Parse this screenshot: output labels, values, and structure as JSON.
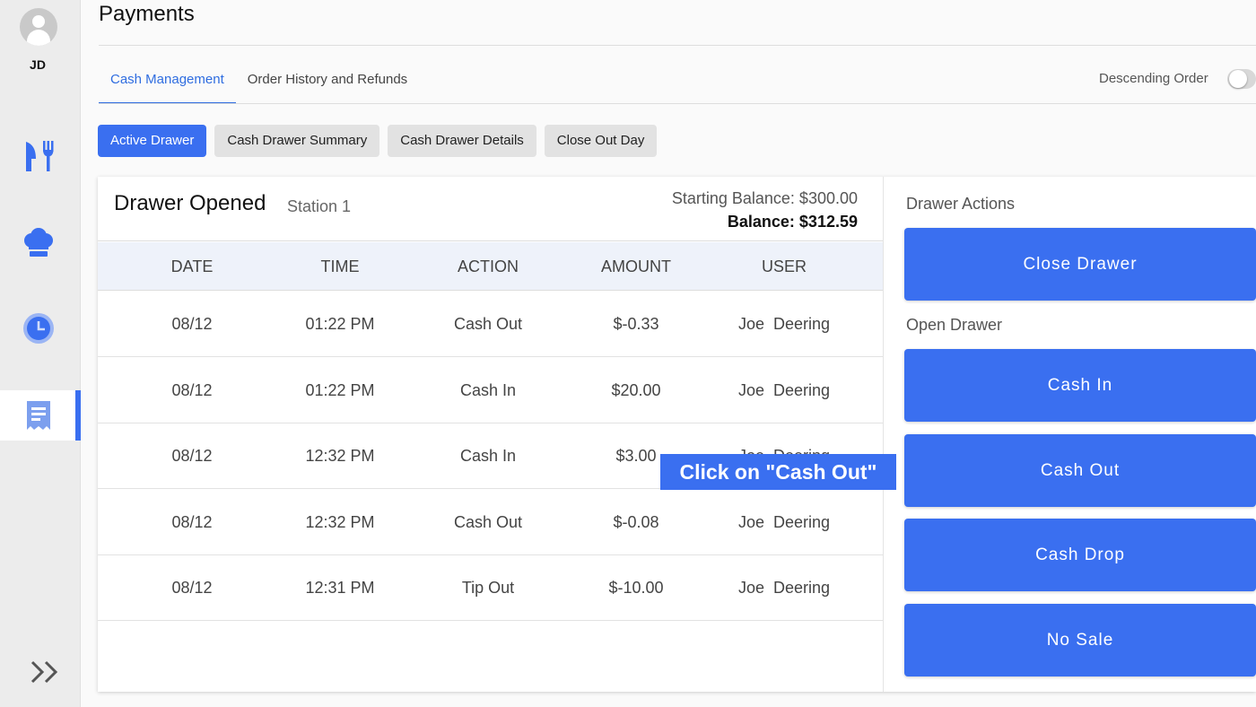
{
  "user": {
    "initials": "JD"
  },
  "page": {
    "title": "Payments"
  },
  "tabs": [
    {
      "label": "Cash Management",
      "active": true
    },
    {
      "label": "Order History and Refunds",
      "active": false
    }
  ],
  "sort": {
    "label": "Descending Order",
    "on": false
  },
  "subtabs": [
    {
      "label": "Active Drawer",
      "active": true
    },
    {
      "label": "Cash Drawer Summary",
      "active": false
    },
    {
      "label": "Cash Drawer Details",
      "active": false
    },
    {
      "label": "Close Out Day",
      "active": false
    }
  ],
  "drawer": {
    "title": "Drawer Opened",
    "station": "Station 1",
    "starting_balance": "Starting Balance: $300.00",
    "balance": "Balance: $312.59"
  },
  "table": {
    "headers": [
      "DATE",
      "TIME",
      "ACTION",
      "AMOUNT",
      "USER"
    ],
    "rows": [
      [
        "08/12",
        "01:22 PM",
        "Cash Out",
        "$-0.33",
        "Joe  Deering"
      ],
      [
        "08/12",
        "01:22 PM",
        "Cash In",
        "$20.00",
        "Joe  Deering"
      ],
      [
        "08/12",
        "12:32 PM",
        "Cash In",
        "$3.00",
        "Joe  Deering"
      ],
      [
        "08/12",
        "12:32 PM",
        "Cash Out",
        "$-0.08",
        "Joe  Deering"
      ],
      [
        "08/12",
        "12:31 PM",
        "Tip Out",
        "$-10.00",
        "Joe  Deering"
      ]
    ]
  },
  "actions": {
    "drawer_actions_label": "Drawer Actions",
    "close_drawer": "Close Drawer",
    "open_drawer_label": "Open Drawer",
    "cash_in": "Cash In",
    "cash_out": "Cash Out",
    "cash_drop": "Cash Drop",
    "no_sale": "No Sale"
  },
  "callout": {
    "text": "Click on \"Cash Out\""
  },
  "colors": {
    "accent": "#3a6ff0",
    "tab_active": "#2f6de0",
    "nav_icon": "#3a6ff0"
  },
  "icons": [
    "user-avatar-icon",
    "restaurant-utensils-icon",
    "chef-hat-icon",
    "clock-icon",
    "receipt-icon",
    "double-chevron-right-icon"
  ]
}
